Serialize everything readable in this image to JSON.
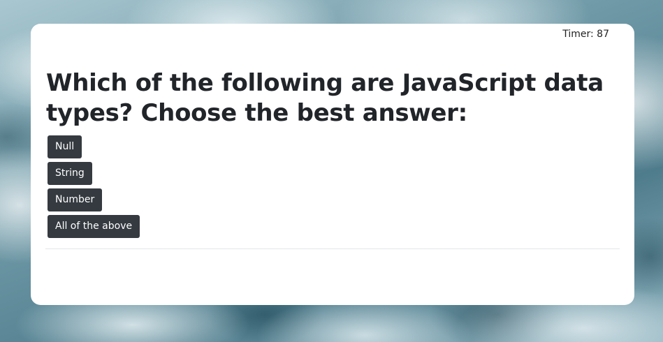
{
  "quiz": {
    "timer": "Timer: 87",
    "question": "Which of the following are JavaScript data types? Choose the best answer:",
    "answers": [
      {
        "label": "Null"
      },
      {
        "label": "String"
      },
      {
        "label": "Number"
      },
      {
        "label": "All of the above"
      }
    ]
  },
  "colors": {
    "button_bg": "#343a40",
    "button_text": "#ffffff",
    "card_bg": "#ffffff",
    "heading_text": "#212529"
  }
}
